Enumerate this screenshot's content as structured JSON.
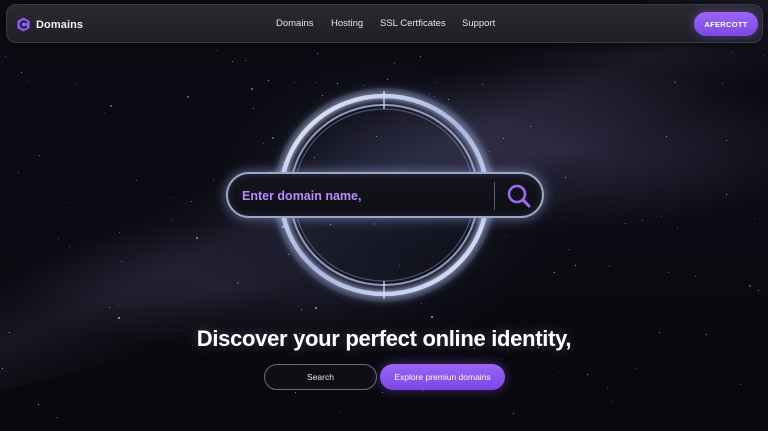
{
  "nav": {
    "brand": "Domains",
    "links": [
      "Domains",
      "Hosting",
      "SSL Certficates",
      "Support"
    ],
    "cta_label": "AFERCOTT"
  },
  "search": {
    "placeholder": "Enter domain name,"
  },
  "hero": {
    "headline": "Discover your perfect online identity,",
    "search_button": "Search",
    "explore_button": "Explore premiun domains"
  },
  "colors": {
    "accent": "#8b5cf6",
    "placeholder": "#b88cff",
    "background": "#0a0a12"
  },
  "icons": {
    "logo": "hexagon-c-logo-icon",
    "search": "magnifier-icon"
  }
}
